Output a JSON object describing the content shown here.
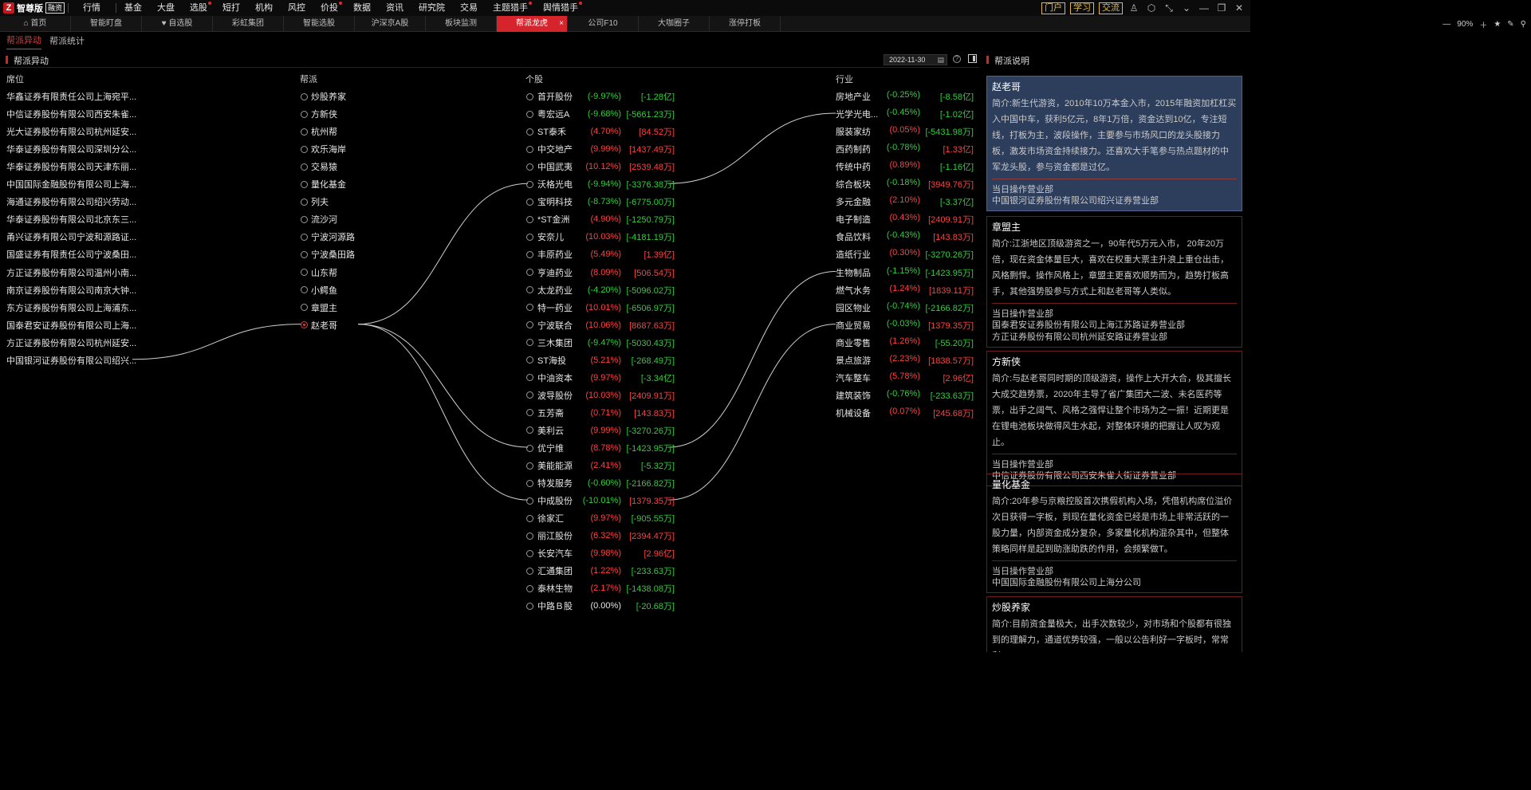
{
  "app": {
    "brand": "智尊版",
    "badge": "融资"
  },
  "menu": [
    {
      "label": "行情",
      "dot": false
    },
    {
      "label": "基金",
      "dot": false
    },
    {
      "label": "大盘",
      "dot": false
    },
    {
      "label": "选股",
      "dot": true
    },
    {
      "label": "短打",
      "dot": false
    },
    {
      "label": "机构",
      "dot": false
    },
    {
      "label": "风控",
      "dot": false
    },
    {
      "label": "价投",
      "dot": true
    },
    {
      "label": "数据",
      "dot": false
    },
    {
      "label": "资讯",
      "dot": false
    },
    {
      "label": "研究院",
      "dot": false
    },
    {
      "label": "交易",
      "dot": false
    },
    {
      "label": "主题猎手",
      "dot": true
    },
    {
      "label": "舆情猎手",
      "dot": true
    }
  ],
  "top_right": {
    "portal": "门户",
    "learn": "学习",
    "chat": "交流"
  },
  "tabs": [
    "首页",
    "智能盯盘",
    "自选股",
    "彩虹集团",
    "智能选股",
    "沪深京A股",
    "板块监测",
    "帮派龙虎",
    "公司F10",
    "大咖圈子",
    "涨停打板"
  ],
  "active_tab": "帮派龙虎",
  "zoom": "90%",
  "subtabs": [
    "帮派异动",
    "帮派统计"
  ],
  "panel": {
    "title": "帮派异动",
    "date": "2022-11-30"
  },
  "columns": {
    "seat": "席位",
    "faction": "帮派",
    "stock": "个股",
    "industry": "行业"
  },
  "seats": [
    "华鑫证券有限责任公司上海宛平...",
    "中信证券股份有限公司西安朱雀...",
    "光大证券股份有限公司杭州延安...",
    "华泰证券股份有限公司深圳分公...",
    "华泰证券股份有限公司天津东丽...",
    "中国国际金融股份有限公司上海...",
    "海通证券股份有限公司绍兴劳动...",
    "华泰证券股份有限公司北京东三...",
    "甬兴证券有限公司宁波和源路证...",
    "国盛证券有限责任公司宁波桑田...",
    "方正证券股份有限公司温州小南...",
    "南京证券股份有限公司南京大钟...",
    "东方证券股份有限公司上海浦东...",
    "国泰君安证券股份有限公司上海...",
    "方正证券股份有限公司杭州延安...",
    "中国银河证券股份有限公司绍兴..."
  ],
  "factions": [
    {
      "name": "炒股养家",
      "selected": false
    },
    {
      "name": "方新侠",
      "selected": false
    },
    {
      "name": "杭州帮",
      "selected": false
    },
    {
      "name": "欢乐海岸",
      "selected": false
    },
    {
      "name": "交易猿",
      "selected": false
    },
    {
      "name": "量化基金",
      "selected": false
    },
    {
      "name": "列夫",
      "selected": false
    },
    {
      "name": "流沙河",
      "selected": false
    },
    {
      "name": "宁波河源路",
      "selected": false
    },
    {
      "name": "宁波桑田路",
      "selected": false
    },
    {
      "name": "山东帮",
      "selected": false
    },
    {
      "name": "小鳄鱼",
      "selected": false
    },
    {
      "name": "章盟主",
      "selected": false
    },
    {
      "name": "赵老哥",
      "selected": true
    }
  ],
  "stocks": [
    {
      "name": "首开股份",
      "pct": "(-9.97%)",
      "amt": "[-1.28亿]",
      "pc": "green",
      "ac": "green"
    },
    {
      "name": "粤宏远A",
      "pct": "(-9.68%)",
      "amt": "[-5661.23万]",
      "pc": "green",
      "ac": "green"
    },
    {
      "name": "ST泰禾",
      "pct": "(4.70%)",
      "amt": "[84.52万]",
      "pc": "red",
      "ac": "red"
    },
    {
      "name": "中交地产",
      "pct": "(9.99%)",
      "amt": "[1437.49万]",
      "pc": "red",
      "ac": "red"
    },
    {
      "name": "中国武夷",
      "pct": "(10.12%)",
      "amt": "[2539.48万]",
      "pc": "red",
      "ac": "red"
    },
    {
      "name": "沃格光电",
      "pct": "(-9.94%)",
      "amt": "[-3376.38万]",
      "pc": "green",
      "ac": "green"
    },
    {
      "name": "宝明科技",
      "pct": "(-8.73%)",
      "amt": "[-6775.00万]",
      "pc": "green",
      "ac": "green"
    },
    {
      "name": "*ST金洲",
      "pct": "(4.90%)",
      "amt": "[-1250.79万]",
      "pc": "red",
      "ac": "green"
    },
    {
      "name": "安奈儿",
      "pct": "(10.03%)",
      "amt": "[-4181.19万]",
      "pc": "red",
      "ac": "green"
    },
    {
      "name": "丰原药业",
      "pct": "(5.49%)",
      "amt": "[1.39亿]",
      "pc": "red",
      "ac": "red"
    },
    {
      "name": "亨迪药业",
      "pct": "(8.09%)",
      "amt": "[506.54万]",
      "pc": "red",
      "ac": "red"
    },
    {
      "name": "太龙药业",
      "pct": "(-4.20%)",
      "amt": "[-5096.02万]",
      "pc": "green",
      "ac": "green"
    },
    {
      "name": "特一药业",
      "pct": "(10.01%)",
      "amt": "[-6506.97万]",
      "pc": "red",
      "ac": "green"
    },
    {
      "name": "宁波联合",
      "pct": "(10.06%)",
      "amt": "[8687.63万]",
      "pc": "red",
      "ac": "red"
    },
    {
      "name": "三木集团",
      "pct": "(-9.47%)",
      "amt": "[-5030.43万]",
      "pc": "green",
      "ac": "green"
    },
    {
      "name": "ST海投",
      "pct": "(5.21%)",
      "amt": "[-268.49万]",
      "pc": "red",
      "ac": "green"
    },
    {
      "name": "中油资本",
      "pct": "(9.97%)",
      "amt": "[-3.34亿]",
      "pc": "red",
      "ac": "green"
    },
    {
      "name": "波导股份",
      "pct": "(10.03%)",
      "amt": "[2409.91万]",
      "pc": "red",
      "ac": "red"
    },
    {
      "name": "五芳斋",
      "pct": "(0.71%)",
      "amt": "[143.83万]",
      "pc": "red",
      "ac": "red"
    },
    {
      "name": "美利云",
      "pct": "(9.99%)",
      "amt": "[-3270.26万]",
      "pc": "red",
      "ac": "green"
    },
    {
      "name": "优宁维",
      "pct": "(8.78%)",
      "amt": "[-1423.95万]",
      "pc": "red",
      "ac": "green"
    },
    {
      "name": "美能能源",
      "pct": "(2.41%)",
      "amt": "[-5.32万]",
      "pc": "red",
      "ac": "green"
    },
    {
      "name": "特发服务",
      "pct": "(-0.60%)",
      "amt": "[-2166.82万]",
      "pc": "green",
      "ac": "green"
    },
    {
      "name": "中成股份",
      "pct": "(-10.01%)",
      "amt": "[1379.35万]",
      "pc": "green",
      "ac": "red"
    },
    {
      "name": "徐家汇",
      "pct": "(9.97%)",
      "amt": "[-905.55万]",
      "pc": "red",
      "ac": "green"
    },
    {
      "name": "丽江股份",
      "pct": "(6.32%)",
      "amt": "[2394.47万]",
      "pc": "red",
      "ac": "red"
    },
    {
      "name": "长安汽车",
      "pct": "(9.98%)",
      "amt": "[2.96亿]",
      "pc": "red",
      "ac": "red"
    },
    {
      "name": "汇通集团",
      "pct": "(1.22%)",
      "amt": "[-233.63万]",
      "pc": "red",
      "ac": "green"
    },
    {
      "name": "泰林生物",
      "pct": "(2.17%)",
      "amt": "[-1438.08万]",
      "pc": "red",
      "ac": "green"
    },
    {
      "name": "中路Ｂ股",
      "pct": "(0.00%)",
      "amt": "[-20.68万]",
      "pc": "white",
      "ac": "green"
    }
  ],
  "industries": [
    {
      "name": "房地产业",
      "pct": "(-0.25%)",
      "amt": "[-8.58亿]",
      "pc": "green",
      "ac": "green"
    },
    {
      "name": "光学光电...",
      "pct": "(-0.45%)",
      "amt": "[-1.02亿]",
      "pc": "green",
      "ac": "green"
    },
    {
      "name": "服装家纺",
      "pct": "(0.05%)",
      "amt": "[-5431.98万]",
      "pc": "red",
      "ac": "green"
    },
    {
      "name": "西药制药",
      "pct": "(-0.78%)",
      "amt": "[1.33亿]",
      "pc": "green",
      "ac": "red"
    },
    {
      "name": "传统中药",
      "pct": "(0.89%)",
      "amt": "[-1.16亿]",
      "pc": "red",
      "ac": "green"
    },
    {
      "name": "综合板块",
      "pct": "(-0.18%)",
      "amt": "[3949.76万]",
      "pc": "green",
      "ac": "red"
    },
    {
      "name": "多元金融",
      "pct": "(2.10%)",
      "amt": "[-3.37亿]",
      "pc": "red",
      "ac": "green"
    },
    {
      "name": "电子制造",
      "pct": "(0.43%)",
      "amt": "[2409.91万]",
      "pc": "red",
      "ac": "red"
    },
    {
      "name": "食品饮料",
      "pct": "(-0.43%)",
      "amt": "[143.83万]",
      "pc": "green",
      "ac": "red"
    },
    {
      "name": "造纸行业",
      "pct": "(0.30%)",
      "amt": "[-3270.26万]",
      "pc": "red",
      "ac": "green"
    },
    {
      "name": "生物制品",
      "pct": "(-1.15%)",
      "amt": "[-1423.95万]",
      "pc": "green",
      "ac": "green"
    },
    {
      "name": "燃气水务",
      "pct": "(1.24%)",
      "amt": "[1839.11万]",
      "pc": "red",
      "ac": "red"
    },
    {
      "name": "园区物业",
      "pct": "(-0.74%)",
      "amt": "[-2166.82万]",
      "pc": "green",
      "ac": "green"
    },
    {
      "name": "商业贸易",
      "pct": "(-0.03%)",
      "amt": "[1379.35万]",
      "pc": "green",
      "ac": "red"
    },
    {
      "name": "商业零售",
      "pct": "(1.26%)",
      "amt": "[-55.20万]",
      "pc": "red",
      "ac": "green"
    },
    {
      "name": "景点旅游",
      "pct": "(2.23%)",
      "amt": "[1838.57万]",
      "pc": "red",
      "ac": "red"
    },
    {
      "name": "汽车整车",
      "pct": "(5.78%)",
      "amt": "[2.96亿]",
      "pc": "red",
      "ac": "red"
    },
    {
      "name": "建筑装饰",
      "pct": "(-0.76%)",
      "amt": "[-233.63万]",
      "pc": "green",
      "ac": "green"
    },
    {
      "name": "机械设备",
      "pct": "(0.07%)",
      "amt": "[245.68万]",
      "pc": "red",
      "ac": "red"
    }
  ],
  "links": {
    "seat_to_faction": [
      {
        "seat": 15,
        "faction": 13
      }
    ],
    "faction_to_stock": [
      {
        "faction": 13,
        "stock": 5
      },
      {
        "faction": 13,
        "stock": 20
      },
      {
        "faction": 13,
        "stock": 23
      }
    ],
    "stock_to_industry": [
      {
        "stock": 5,
        "industry": 1
      },
      {
        "stock": 20,
        "industry": 10
      },
      {
        "stock": 23,
        "industry": 13
      }
    ]
  },
  "right_panel": {
    "title": "帮派说明",
    "cards": [
      {
        "name": "赵老哥",
        "selected": true,
        "desc": "简介:新生代游资，2010年10万本金入市，2015年融资加杠杠买入中国中车，获利5亿元，8年1万倍，资金达到10亿，专注短线，打板为主，波段操作，主要参与市场风口的龙头股接力板，激发市场资金持续接力。还喜欢大手笔参与热点题材的中军龙头股，参与资金都是过亿。",
        "label": "当日操作营业部",
        "deps": [
          "中国银河证券股份有限公司绍兴证券营业部"
        ]
      },
      {
        "name": "章盟主",
        "selected": false,
        "desc": "简介:江浙地区顶级游资之一，90年代5万元入市， 20年20万倍，现在资金体量巨大，喜欢在权重大票主升浪上重仓出击，风格剽悍。操作风格上，章盟主更喜欢顺势而为，趋势打板高手，其他强势股参与方式上和赵老哥等人类似。",
        "label": "当日操作营业部",
        "deps": [
          "国泰君安证券股份有限公司上海江苏路证券营业部",
          "方正证券股份有限公司杭州延安路证券营业部"
        ]
      },
      {
        "name": "方新侠",
        "selected": false,
        "desc": "简介:与赵老哥同时期的顶级游资，操作上大开大合，极其擅长大成交趋势票，2020年主导了省广集团大二波、未名医药等票，出手之阔气、风格之强悍让整个市场为之一振！近期更是在锂电池板块做得风生水起，对整体环境的把握让人叹为观止。",
        "label": "当日操作营业部",
        "deps": [
          "中信证券股份有限公司西安朱雀大街证券营业部"
        ]
      },
      {
        "name": "量化基金",
        "selected": false,
        "desc": "简介:20年参与京粮控股首次携假机构入场，凭借机构席位溢价次日获得一字板，到现在量化资金已经是市场上非常活跃的一股力量，内部资金成分复杂，多家量化机构混杂其中，但整体策略同样是起到助涨助跌的作用，会频繁做T。",
        "label": "当日操作营业部",
        "deps": [
          "中国国际金融股份有限公司上海分公司"
        ]
      },
      {
        "name": "炒股养家",
        "selected": false,
        "desc": "简介:目前资金量极大，出手次数较少，对市场和个股都有很独到的理解力，通道优势较强，一般以公告利好一字板时，常常利",
        "label": "",
        "deps": []
      }
    ]
  }
}
